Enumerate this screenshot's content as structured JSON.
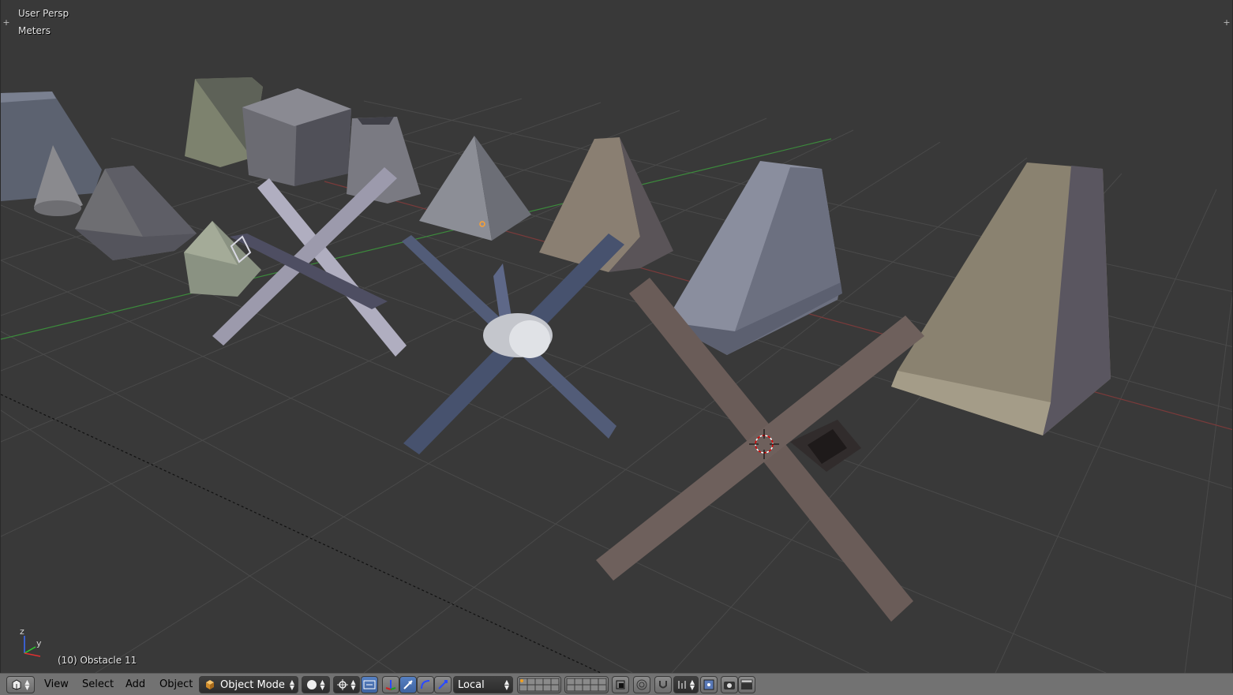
{
  "viewport": {
    "view_label": "User Persp",
    "units_label": "Meters",
    "active_object": "(10) Obstacle 11",
    "axis": {
      "x": "x",
      "y": "y",
      "z": "z"
    }
  },
  "header": {
    "editor_type_icon": "3d-view-icon",
    "menus": [
      "View",
      "Select",
      "Add",
      "Object"
    ],
    "mode": {
      "label": "Object Mode",
      "icon": "cube-icon"
    },
    "shading_icon": "solid-sphere-icon",
    "pivot_icon": "pivot-point-icon",
    "transform_orientation": "Local",
    "colors": {
      "header_bg": "#727272",
      "viewport_bg": "#393939",
      "active_blue": "#5680c2"
    }
  }
}
